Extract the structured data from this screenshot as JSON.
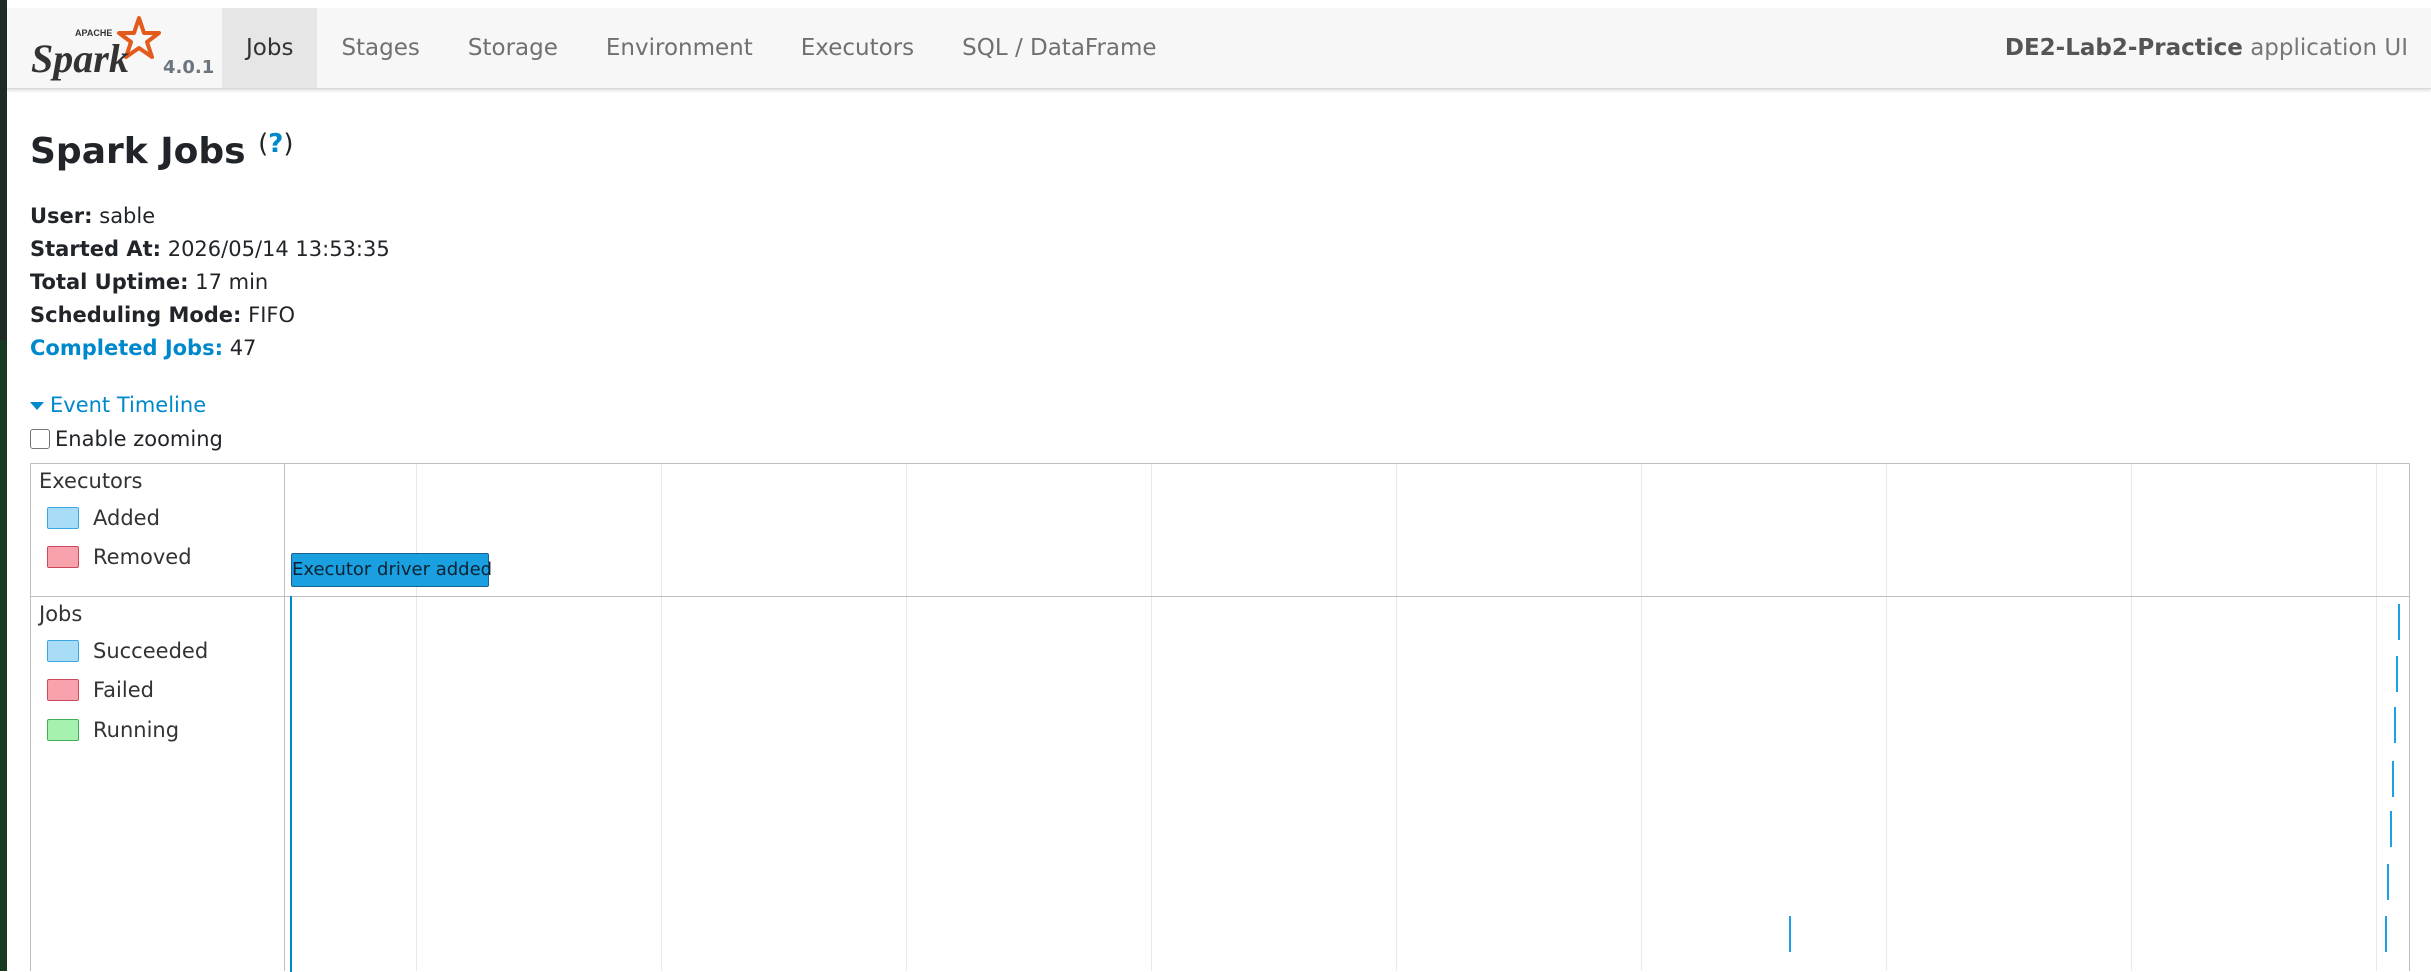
{
  "brand": {
    "apache": "APACHE",
    "name": "Spark",
    "version": "4.0.1"
  },
  "nav": {
    "tabs": [
      {
        "label": "Jobs",
        "active": true
      },
      {
        "label": "Stages",
        "active": false
      },
      {
        "label": "Storage",
        "active": false
      },
      {
        "label": "Environment",
        "active": false
      },
      {
        "label": "Executors",
        "active": false
      },
      {
        "label": "SQL / DataFrame",
        "active": false
      }
    ],
    "app_name": "DE2-Lab2-Practice",
    "app_suffix": "application UI"
  },
  "page": {
    "title": "Spark Jobs",
    "help": "?"
  },
  "info": {
    "user_label": "User:",
    "user": "sable",
    "started_label": "Started At:",
    "started": "2026/05/14 13:53:35",
    "uptime_label": "Total Uptime:",
    "uptime": "17 min",
    "mode_label": "Scheduling Mode:",
    "mode": "FIFO",
    "completed_label": "Completed Jobs:",
    "completed": "47"
  },
  "timeline": {
    "toggle_label": "Event Timeline",
    "zoom_label": "Enable zooming",
    "zoom_enabled": false,
    "executors": {
      "label": "Executors",
      "legend": [
        {
          "label": "Added",
          "color": "#a9dcf7",
          "border": "#3aa8e0"
        },
        {
          "label": "Removed",
          "color": "#f8a2ad",
          "border": "#c94a5a"
        }
      ],
      "event_label": "Executor driver added"
    },
    "jobs": {
      "label": "Jobs",
      "legend": [
        {
          "label": "Succeeded",
          "color": "#a9dcf7",
          "border": "#3aa8e0"
        },
        {
          "label": "Failed",
          "color": "#f8a2ad",
          "border": "#c94a5a"
        },
        {
          "label": "Running",
          "color": "#a6f0b0",
          "border": "#3fae55"
        }
      ]
    }
  },
  "colors": {
    "link": "#0088cc",
    "nav_active": "#e6e6e6",
    "executor_box": "#1a9fe0"
  }
}
